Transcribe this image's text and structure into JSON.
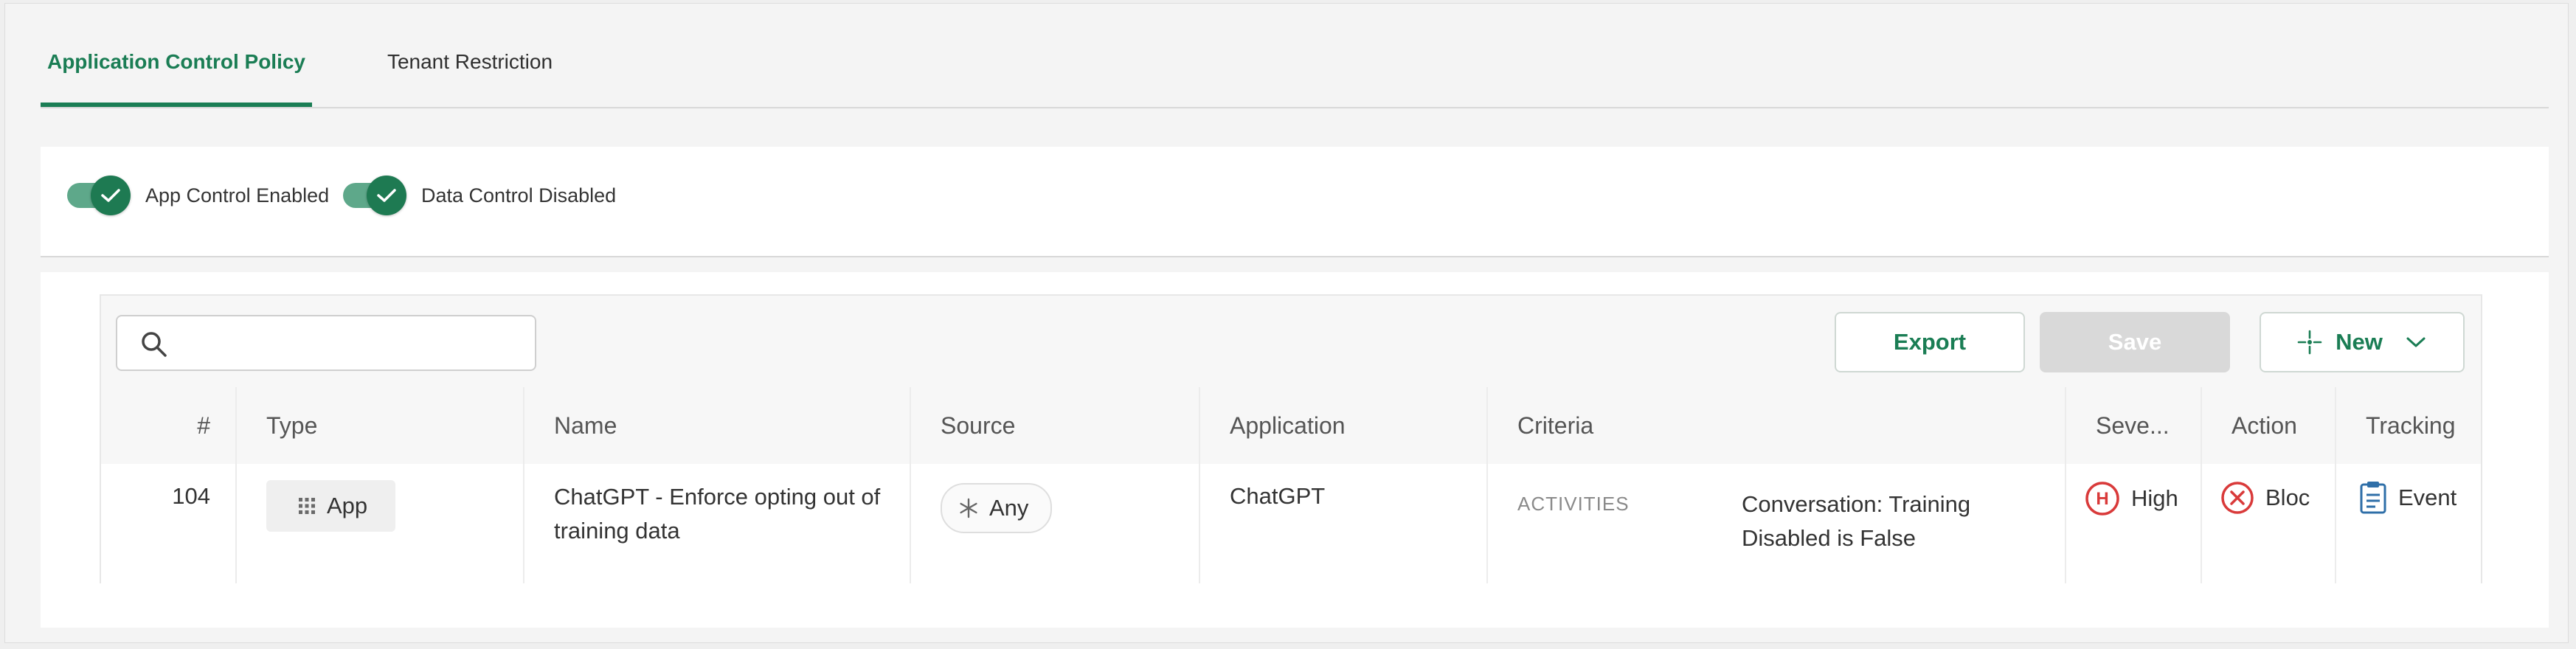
{
  "tabs": [
    {
      "label": "Application Control Policy",
      "active": true
    },
    {
      "label": "Tenant Restriction",
      "active": false
    }
  ],
  "toggles": [
    {
      "label": "App Control Enabled",
      "on": true
    },
    {
      "label": "Data Control Disabled",
      "on": true
    }
  ],
  "search": {
    "placeholder": "",
    "value": ""
  },
  "toolbar": {
    "export_label": "Export",
    "save_label": "Save",
    "new_label": "New"
  },
  "table": {
    "headers": [
      "#",
      "Type",
      "Name",
      "Source",
      "Application",
      "Criteria",
      "Seve...",
      "Action",
      "Tracking"
    ],
    "rows": [
      {
        "num": "104",
        "type": "App",
        "name": "ChatGPT - Enforce opting out of training data",
        "source": "Any",
        "application": "ChatGPT",
        "criteria_label": "ACTIVITIES",
        "criteria_value": "Conversation: Training Disabled is False",
        "severity": "High",
        "action": "Bloc",
        "tracking": "Event"
      }
    ]
  },
  "colors": {
    "accent": "#1a7d54",
    "toggle_track": "#5ea88a",
    "severity_high": "#d93a3a",
    "action_block": "#d93a3a",
    "tracking_icon": "#2f6fa8"
  },
  "icons": {
    "search": "search-icon",
    "toggle_check": "check-icon",
    "new": "sparkle-icon",
    "new_dropdown": "chevron-down-icon",
    "type": "grid-icon",
    "source": "asterisk-icon",
    "severity": "high-severity-icon",
    "action": "block-icon",
    "tracking": "document-icon"
  }
}
